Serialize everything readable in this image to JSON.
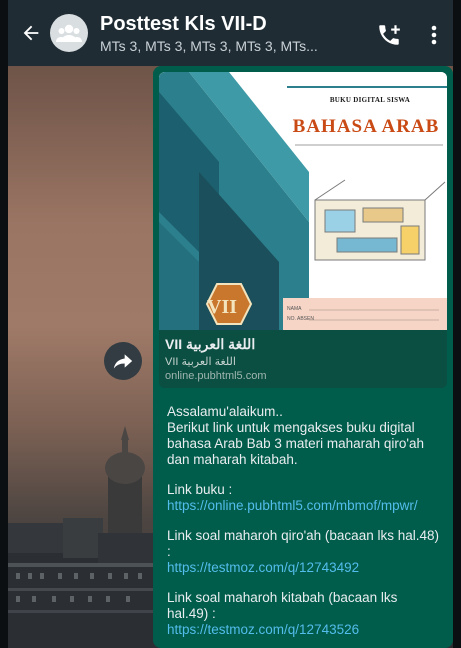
{
  "header": {
    "title": "Posttest Kls VII-D",
    "subtitle": "MTs 3, MTs 3, MTs 3, MTs 3, MTs..."
  },
  "preview": {
    "cover_eyebrow": "BUKU DIGITAL SISWA",
    "cover_title": "BAHASA ARAB",
    "cover_badge": "VII",
    "cover_field_name": "NAMA",
    "cover_field_no": "NO. ABSEN",
    "title": "VII اللغة العربية",
    "description": "VII اللغة العربية",
    "url": "online.pubhtml5.com"
  },
  "message": {
    "greeting": "Assalamu'alaikum..",
    "intro": "Berikut link untuk mengakses buku digital bahasa Arab Bab 3 materi maharah qiro'ah dan maharah kitabah.",
    "book_label": "Link buku :",
    "book_link": "https://online.pubhtml5.com/mbmof/mpwr/",
    "qiroah_label": "Link soal maharoh qiro'ah (bacaan lks hal.48) :",
    "qiroah_link": "https://testmoz.com/q/12743492",
    "kitabah_label": "Link soal maharoh kitabah (bacaan lks hal.49) :",
    "kitabah_link": "https://testmoz.com/q/12743526"
  },
  "icons": {
    "back": "arrow-left-icon",
    "avatar": "group-icon",
    "call": "add-call-icon",
    "menu": "more-vertical-icon",
    "forward": "forward-icon"
  },
  "colors": {
    "header_bg": "#1f2c34",
    "bubble_bg": "#005c4b",
    "link": "#53bdeb"
  }
}
